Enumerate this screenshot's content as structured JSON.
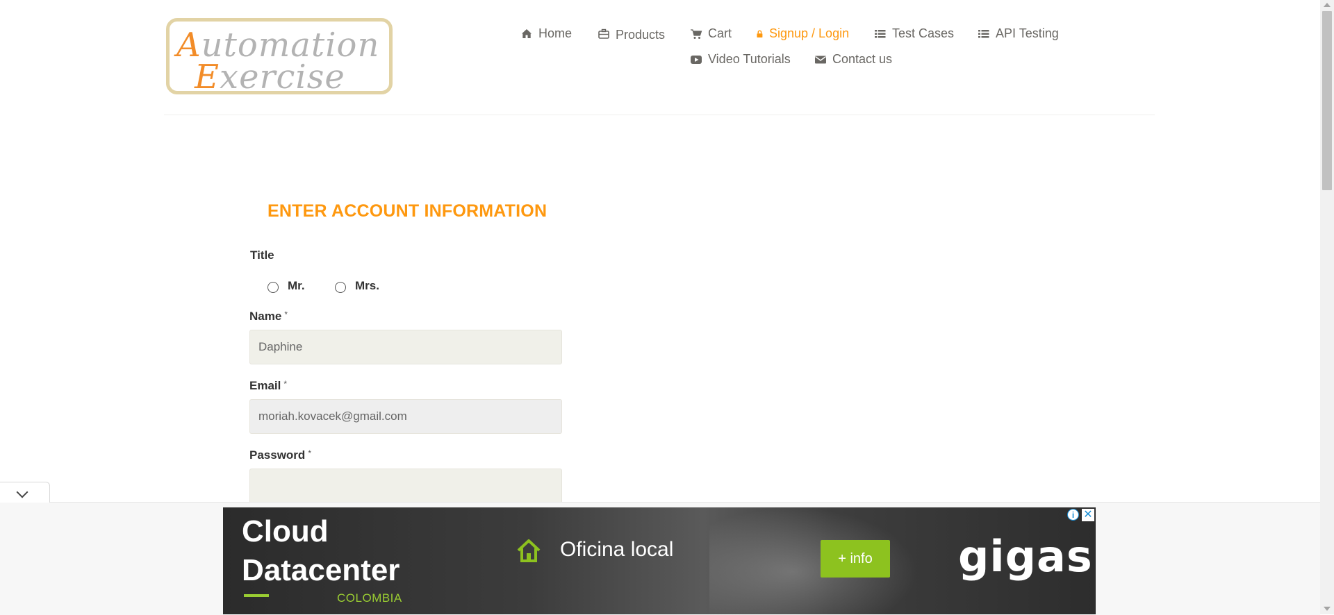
{
  "logo": {
    "line1_cap": "A",
    "line1_rest": "utomation",
    "line2_cap": "E",
    "line2_rest": "xercise"
  },
  "nav": {
    "items": [
      {
        "label": "Home",
        "icon": "home-icon"
      },
      {
        "label": "Products",
        "icon": "briefcase-icon"
      },
      {
        "label": "Cart",
        "icon": "cart-icon"
      },
      {
        "label": "Signup / Login",
        "icon": "lock-icon",
        "active": true
      },
      {
        "label": "Test Cases",
        "icon": "list-icon"
      },
      {
        "label": "API Testing",
        "icon": "list-icon"
      },
      {
        "label": "Video Tutorials",
        "icon": "youtube-icon"
      },
      {
        "label": "Contact us",
        "icon": "envelope-icon"
      }
    ],
    "active_color": "#fe980f"
  },
  "form": {
    "heading": "ENTER ACCOUNT INFORMATION",
    "title_label": "Title",
    "title_options": [
      "Mr.",
      "Mrs."
    ],
    "name_label": "Name",
    "name_value": "Daphine",
    "email_label": "Email",
    "email_value": "moriah.kovacek@gmail.com",
    "password_label": "Password",
    "password_value": "",
    "required_mark": "*"
  },
  "ad": {
    "headline_1": "Cloud",
    "headline_2": "Datacenter",
    "country": "COLOMBIA",
    "office": "Oficina local",
    "button": "+ info",
    "brand": "gigas",
    "info_glyph": "i",
    "close_glyph": "✕",
    "accent": "#8dc21f"
  }
}
